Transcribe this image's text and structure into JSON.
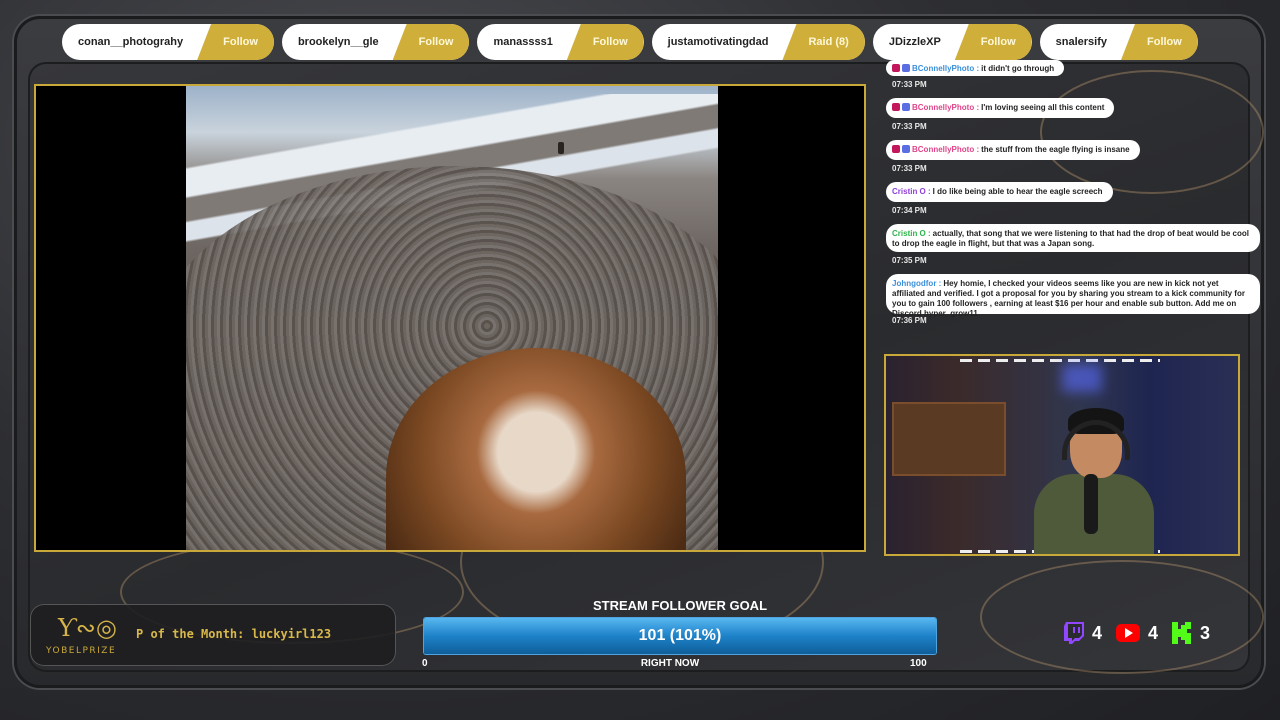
{
  "events": [
    {
      "name": "conan__photograhy",
      "action": "Follow"
    },
    {
      "name": "brookelyn__gle",
      "action": "Follow"
    },
    {
      "name": "manassss1",
      "action": "Follow"
    },
    {
      "name": "justamotivatingdad",
      "action": "Raid (8)"
    },
    {
      "name": "JDizzleXP",
      "action": "Follow"
    },
    {
      "name": "snalersify",
      "action": "Follow"
    }
  ],
  "chat": [
    {
      "user": "BConnellyPhoto :",
      "text": "it didn't go through",
      "time": "07:33 PM",
      "user_color": "#3b8fd9"
    },
    {
      "user": "BConnellyPhoto :",
      "text": "I'm loving seeing all this content",
      "time": "07:33 PM",
      "user_color": "#e0458a"
    },
    {
      "user": "BConnellyPhoto :",
      "text": "the stuff from the eagle flying is insane",
      "time": "07:33 PM",
      "user_color": "#e0458a"
    },
    {
      "user": "Cristin O :",
      "text": "I do like being able to hear the eagle screech",
      "time": "07:34 PM",
      "user_color": "#8e3fd6"
    },
    {
      "user": "Cristin O :",
      "text": "actually, that song that we were listening to that had the drop of beat would be cool to drop the eagle in flight, but that was a Japan song.",
      "time": "07:35 PM",
      "user_color": "#2fb34a"
    },
    {
      "user": "Johngodfor :",
      "text": "Hey homie, I checked your videos seems like you are new in kick not yet affiliated and verified. I got a proposal for you by sharing you stream to a kick community for you to gain 100 followers , earning at least $16 per hour and enable sub button. Add me on Discord hyper_grow11",
      "time": "07:36 PM",
      "user_color": "#3b8fd9"
    }
  ],
  "member": {
    "text": "P of the Month: luckyirl123"
  },
  "logo": {
    "mark": "Ƴ∾◎",
    "text": "YOBELPRIZE"
  },
  "goal": {
    "title": "STREAM FOLLOWER GOAL",
    "value_text": "101 (101%)",
    "progress": 1.0,
    "min": "0",
    "label": "RIGHT NOW",
    "max": "100"
  },
  "socials": [
    {
      "platform": "twitch",
      "icon": "twitch-icon",
      "count": "4",
      "color": "#9146ff"
    },
    {
      "platform": "youtube",
      "icon": "youtube-icon",
      "count": "4",
      "color": "#ff0000"
    },
    {
      "platform": "kick",
      "icon": "kick-icon",
      "count": "3",
      "color": "#53fc18"
    }
  ]
}
